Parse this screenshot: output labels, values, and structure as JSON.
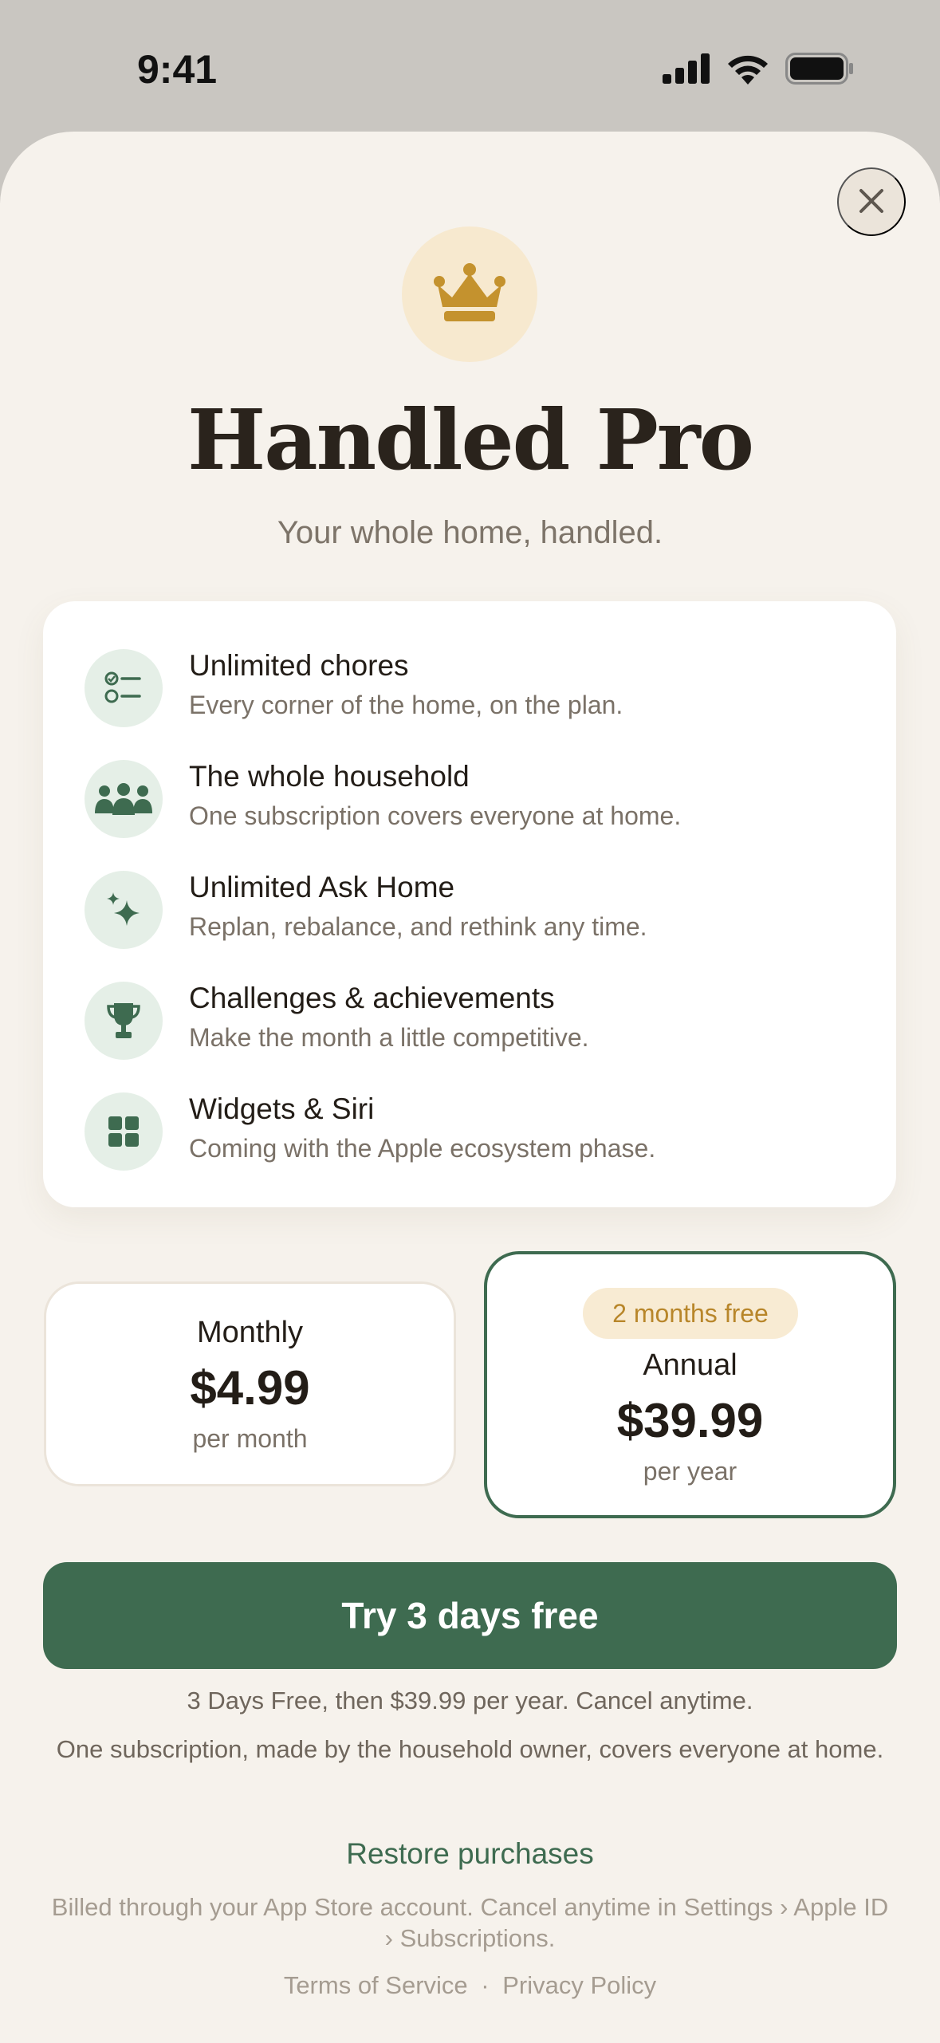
{
  "status_bar": {
    "time": "9:41"
  },
  "header": {
    "title": "Handled Pro",
    "subtitle": "Your whole home, handled."
  },
  "features": [
    {
      "icon": "checklist-icon",
      "title": "Unlimited chores",
      "desc": "Every corner of the home, on the plan."
    },
    {
      "icon": "people-icon",
      "title": "The whole household",
      "desc": "One subscription covers everyone at home."
    },
    {
      "icon": "sparkle-icon",
      "title": "Unlimited Ask Home",
      "desc": "Replan, rebalance, and rethink any time."
    },
    {
      "icon": "trophy-icon",
      "title": "Challenges & achievements",
      "desc": "Make the month a little competitive."
    },
    {
      "icon": "widgets-icon",
      "title": "Widgets & Siri",
      "desc": "Coming with the Apple ecosystem phase."
    }
  ],
  "plans": {
    "monthly": {
      "name": "Monthly",
      "price": "$4.99",
      "period": "per month",
      "selected": false
    },
    "annual": {
      "badge": "2 months free",
      "name": "Annual",
      "price": "$39.99",
      "period": "per year",
      "selected": true
    }
  },
  "cta": {
    "label": "Try 3 days free"
  },
  "fine_print": {
    "trial": "3 Days Free, then $39.99 per year. Cancel anytime.",
    "household": "One subscription, made by the household owner, covers everyone at home."
  },
  "restore_label": "Restore purchases",
  "billing_note": "Billed through your App Store account. Cancel anytime in Settings › Apple ID › Subscriptions.",
  "legal": {
    "terms": "Terms of Service",
    "separator": "·",
    "privacy": "Privacy Policy"
  },
  "colors": {
    "accent": "#3e6b50",
    "gold": "#c4922e",
    "background": "#f6f2ec",
    "badge_bg": "#f8ebd3"
  }
}
